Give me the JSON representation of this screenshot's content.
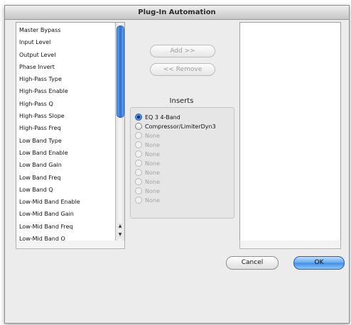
{
  "window": {
    "title": "Plug-In Automation"
  },
  "params": [
    "Master Bypass",
    "Input Level",
    "Output Level",
    "Phase Invert",
    "High-Pass Type",
    "High-Pass Enable",
    "High-Pass Q",
    "High-Pass Slope",
    "High-Pass Freq",
    "Low Band Type",
    "Low Band Enable",
    "Low Band Gain",
    "Low Band Freq",
    "Low Band Q",
    "Low-Mid Band Enable",
    "Low-Mid Band Gain",
    "Low-Mid Band Freq",
    "Low-Mid Band Q"
  ],
  "buttons": {
    "add": "Add >>",
    "remove": "<< Remove",
    "cancel": "Cancel",
    "ok": "OK"
  },
  "inserts": {
    "title": "Inserts",
    "options": [
      {
        "label": "EQ 3 4-Band",
        "selected": true,
        "enabled": true
      },
      {
        "label": "Compressor/LimiterDyn3",
        "selected": false,
        "enabled": true
      },
      {
        "label": "None",
        "selected": false,
        "enabled": false
      },
      {
        "label": "None",
        "selected": false,
        "enabled": false
      },
      {
        "label": "None",
        "selected": false,
        "enabled": false
      },
      {
        "label": "None",
        "selected": false,
        "enabled": false
      },
      {
        "label": "None",
        "selected": false,
        "enabled": false
      },
      {
        "label": "None",
        "selected": false,
        "enabled": false
      },
      {
        "label": "None",
        "selected": false,
        "enabled": false
      },
      {
        "label": "None",
        "selected": false,
        "enabled": false
      }
    ]
  },
  "colors": {
    "accent": "#3f8ee6",
    "disabled_text": "#a3a3a3"
  },
  "icons": {
    "scroll_up": "▲",
    "scroll_down": "▼"
  }
}
